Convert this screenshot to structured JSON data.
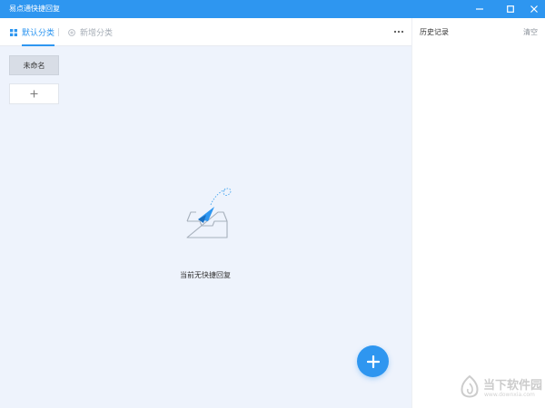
{
  "window": {
    "title": "易点通快捷回复",
    "controls": {
      "minimize": "minimize-icon",
      "maximize": "maximize-icon",
      "close": "close-icon"
    }
  },
  "tabs": [
    {
      "label": "默认分类",
      "icon": "grid-icon",
      "active": true
    },
    {
      "label": "新增分类",
      "icon": "add-circle-icon",
      "active": false
    }
  ],
  "more_menu": {
    "icon": "more-dots-icon"
  },
  "categories": [
    {
      "label": "未命名"
    }
  ],
  "add_category": {
    "icon": "plus-icon"
  },
  "empty_state": {
    "icon": "paper-plane-inbox-icon",
    "text": "当前无快捷回复"
  },
  "add_reply_button": {
    "icon": "plus-icon"
  },
  "history": {
    "title": "历史记录",
    "clear_label": "清空"
  },
  "watermark": {
    "name": "当下软件园",
    "url": "www.downxia.com"
  },
  "colors": {
    "accent": "#2e96f0",
    "pane_background": "#eef3fc",
    "category_button": "#d8dde6"
  }
}
